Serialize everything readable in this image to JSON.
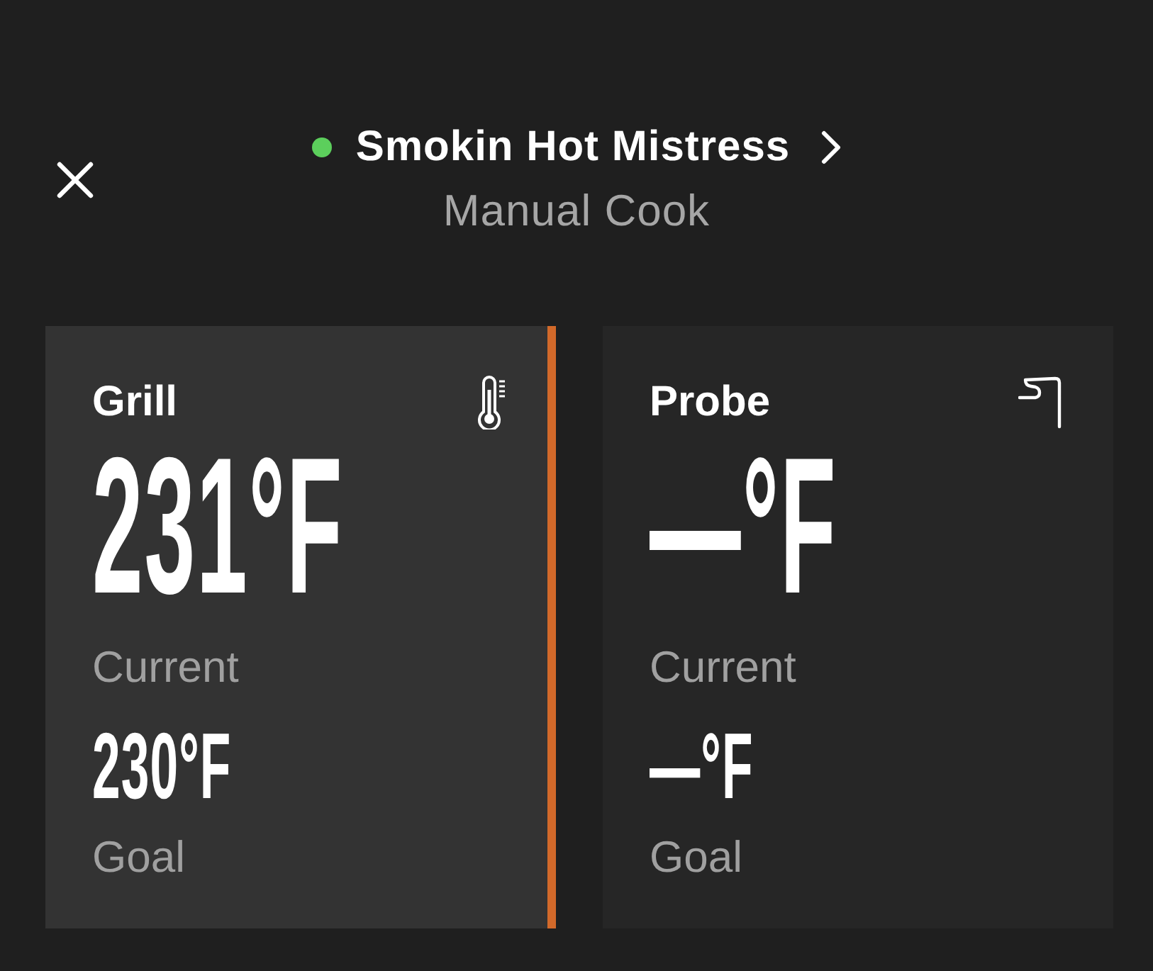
{
  "header": {
    "device": {
      "name": "Smokin Hot Mistress",
      "connected": true
    },
    "mode": "Manual Cook"
  },
  "cards": [
    {
      "kind": "grill",
      "title": "Grill",
      "selected": true,
      "current": {
        "value": "231°F",
        "label": "Current"
      },
      "goal": {
        "value": "230°F",
        "label": "Goal"
      }
    },
    {
      "kind": "probe",
      "title": "Probe",
      "selected": false,
      "current": {
        "value": "—°F",
        "label": "Current"
      },
      "goal": {
        "value": "—°F",
        "label": "Goal"
      }
    }
  ]
}
